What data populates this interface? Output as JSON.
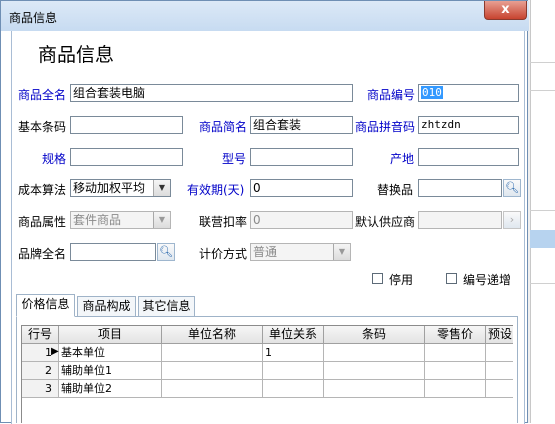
{
  "window": {
    "title": "商品信息",
    "close_glyph": "x"
  },
  "form": {
    "heading": "商品信息",
    "full_name_label": "商品全名",
    "full_name_value": "组合套装电脑",
    "code_label": "商品编号",
    "code_value": "010",
    "barcode_label": "基本条码",
    "barcode_value": "",
    "short_name_label": "商品简名",
    "short_name_value": "组合套装",
    "pinyin_label": "商品拼音码",
    "pinyin_value": "zhtzdn",
    "spec_label": "规格",
    "spec_value": "",
    "model_label": "型号",
    "model_value": "",
    "origin_label": "产地",
    "origin_value": "",
    "cost_method_label": "成本算法",
    "cost_method_value": "移动加权平均",
    "expiry_label": "有效期(天)",
    "expiry_value": "0",
    "substitute_label": "替换品",
    "substitute_value": "",
    "attribute_label": "商品属性",
    "attribute_value": "套件商品",
    "joint_discount_label": "联营扣率",
    "joint_discount_value": "0",
    "default_supplier_label": "默认供应商",
    "default_supplier_value": "",
    "brand_label": "品牌全名",
    "brand_value": "",
    "pricing_method_label": "计价方式",
    "pricing_method_value": "普通",
    "disable_label": "停用",
    "auto_increment_label": "编号递增"
  },
  "tabs": [
    {
      "label": "价格信息",
      "active": true
    },
    {
      "label": "商品构成",
      "active": false
    },
    {
      "label": "其它信息",
      "active": false
    }
  ],
  "grid": {
    "columns": [
      "行号",
      "项目",
      "单位名称",
      "单位关系",
      "条码",
      "零售价",
      "预设"
    ],
    "rows": [
      {
        "no": "1",
        "item": "基本单位",
        "unit_name": "",
        "relation": "1",
        "barcode": "",
        "retail": "",
        "preset": ""
      },
      {
        "no": "2",
        "item": "辅助单位1",
        "unit_name": "",
        "relation": "",
        "barcode": "",
        "retail": "",
        "preset": ""
      },
      {
        "no": "3",
        "item": "辅助单位2",
        "unit_name": "",
        "relation": "",
        "barcode": "",
        "retail": "",
        "preset": ""
      }
    ],
    "current_row_marker": "▶"
  },
  "icons": {
    "dropdown": "chevron-down-icon",
    "search": "magnifier-icon",
    "more": "chevron-right-icon"
  },
  "colors": {
    "label_blue": "#0000c8",
    "title_gradient_top": "#dce9f7",
    "close_red": "#c7432f",
    "selection": "#3399ff"
  }
}
